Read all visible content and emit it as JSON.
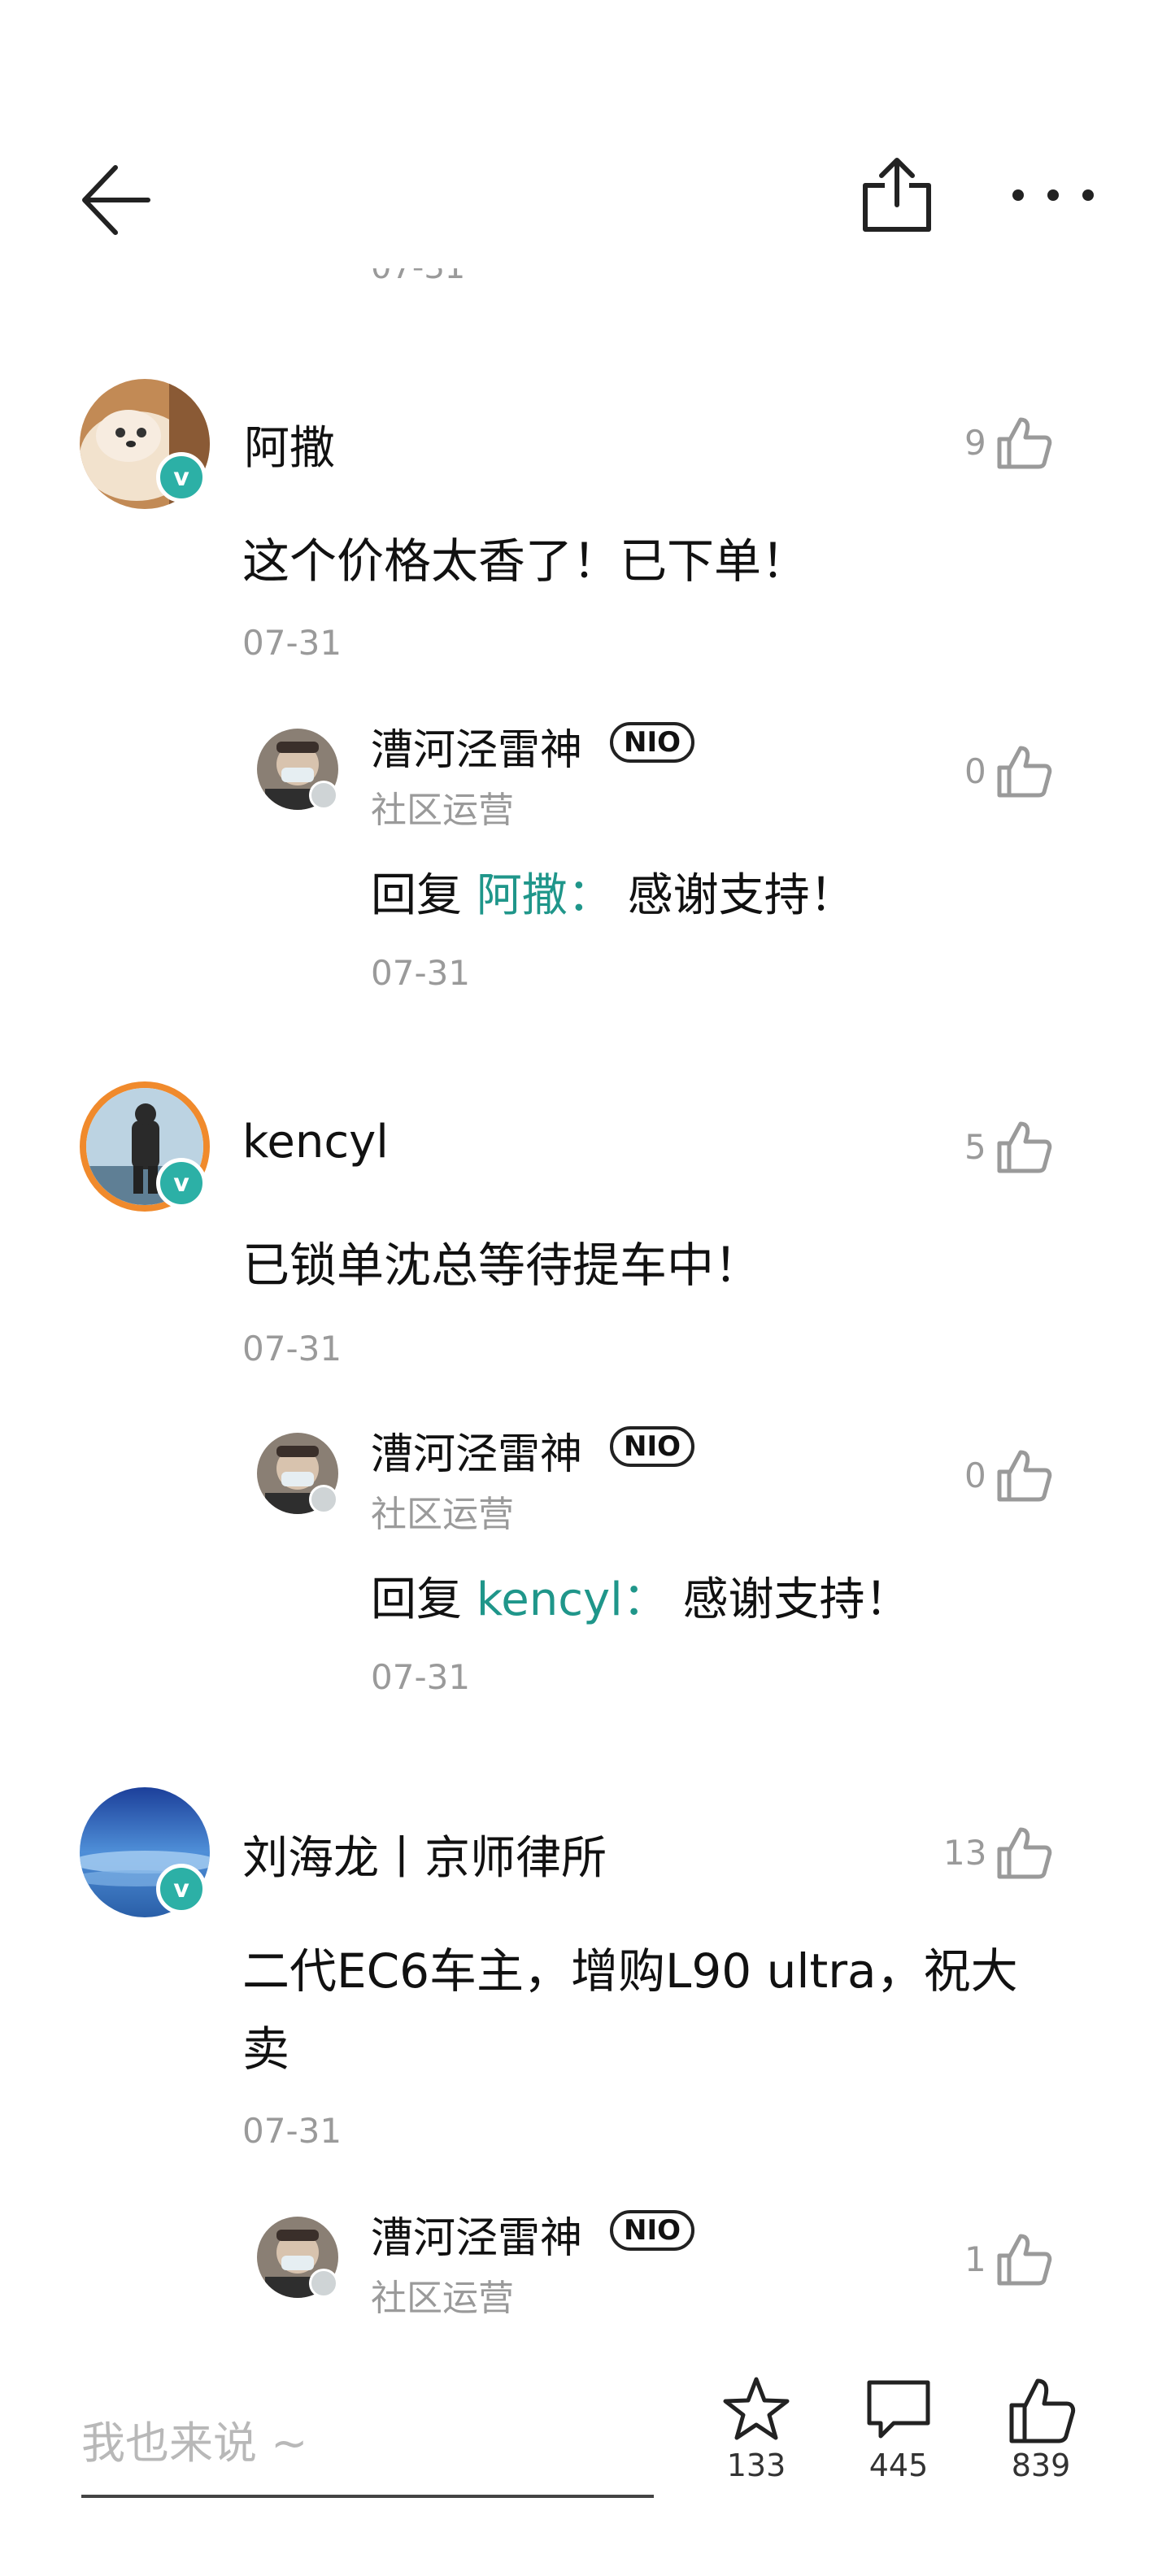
{
  "header": {
    "stub_date": "07-31"
  },
  "comments": [
    {
      "user": "阿撒",
      "text": "这个价格太香了！已下单！",
      "date": "07-31",
      "likes": "9",
      "reply": {
        "user": "漕河泾雷神",
        "badge": "NIO",
        "role": "社区运营",
        "prefix": "回复",
        "target": "阿撒：",
        "text": "感谢支持！",
        "date": "07-31",
        "likes": "0"
      }
    },
    {
      "user": "kencyl",
      "text": "已锁单沈总等待提车中！",
      "date": "07-31",
      "likes": "5",
      "reply": {
        "user": "漕河泾雷神",
        "badge": "NIO",
        "role": "社区运营",
        "prefix": "回复",
        "target": "kencyl：",
        "text": "感谢支持！",
        "date": "07-31",
        "likes": "0"
      }
    },
    {
      "user": "刘海龙丨京师律所",
      "text": "二代EC6车主，增购L90 ultra，祝大\n卖",
      "date": "07-31",
      "likes": "13",
      "reply": {
        "user": "漕河泾雷神",
        "badge": "NIO",
        "role": "社区运营",
        "likes": "1"
      }
    }
  ],
  "badge_verified": "v",
  "bottom": {
    "placeholder": "我也来说 ~",
    "favorites": "133",
    "comments": "445",
    "likes": "839"
  },
  "colors": {
    "accent": "#1f968a",
    "verified": "#2cb0a6",
    "muted": "#9a9a9a"
  }
}
